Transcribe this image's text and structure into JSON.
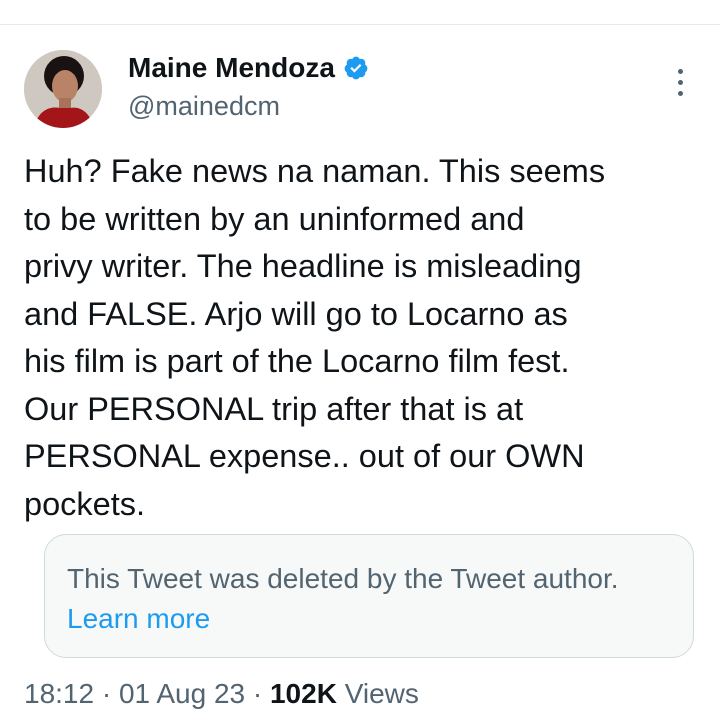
{
  "author": {
    "display_name": "Maine Mendoza",
    "handle": "@mainedcm",
    "verified_color": "#1d9bf0",
    "avatar_icon": "profile-photo"
  },
  "tweet": {
    "text": "Huh? Fake news na naman. This seems\nto be written by an uninformed and\nprivy writer. The headline is misleading\nand FALSE. Arjo will go to Locarno as\nhis film is part of the Locarno film fest.\nOur PERSONAL trip after that is at\nPERSONAL expense.. out of our OWN\npockets."
  },
  "quoted": {
    "deleted_text": "This Tweet was deleted by the Tweet author.",
    "learn_more": "Learn more"
  },
  "meta": {
    "time": "18:12",
    "separator": "·",
    "date": "01 Aug 23",
    "views_count": "102K",
    "views_label": "Views"
  },
  "colors": {
    "text": "#0f1419",
    "secondary": "#536471",
    "link": "#1d9bf0",
    "card_bg": "#f7f9f9",
    "card_border": "#cfd9de"
  }
}
